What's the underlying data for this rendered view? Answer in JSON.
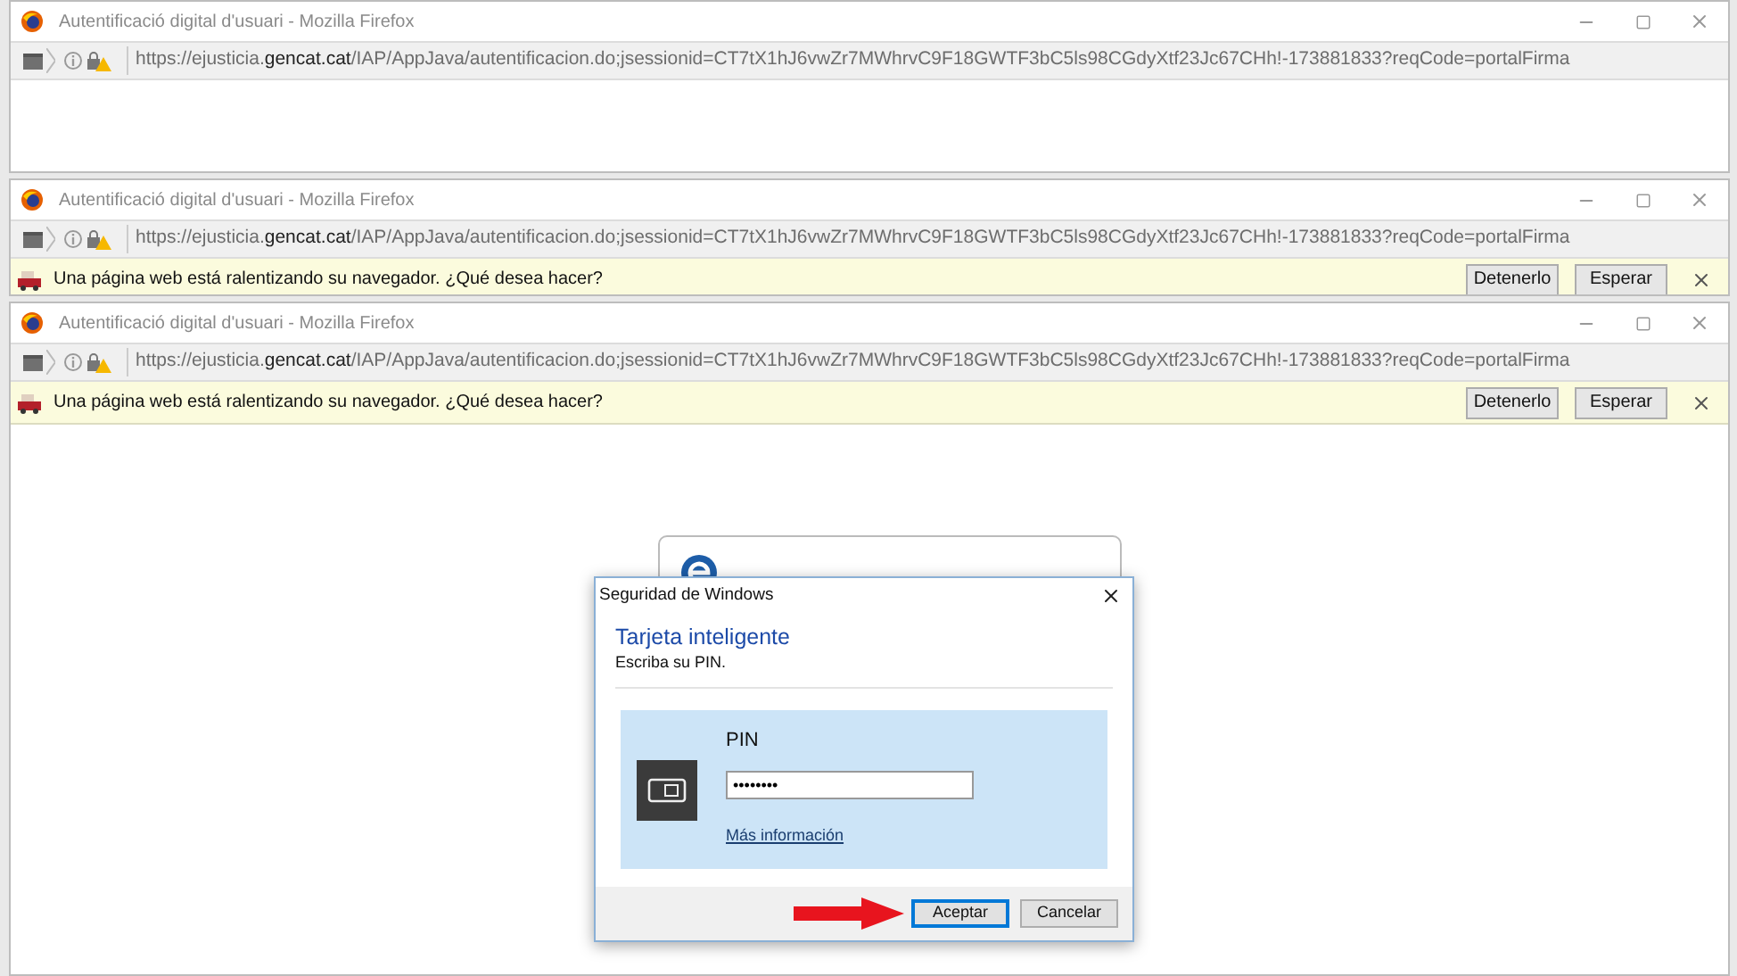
{
  "windows": [
    {
      "title": "Autentificació digital d'usuari - Mozilla Firefox",
      "url": {
        "scheme": "https://ejusticia.",
        "domain": "gencat.cat",
        "path": "/IAP/AppJava/autentificacion.do;jsessionid=CT7tX1hJ6vwZr7MWhrvC9F18GWTF3bC5ls98CGdyXtf23Jc67CHh!-173881833?reqCode=portalFirma"
      }
    },
    {
      "title": "Autentificació digital d'usuari - Mozilla Firefox",
      "url": {
        "scheme": "https://ejusticia.",
        "domain": "gencat.cat",
        "path": "/IAP/AppJava/autentificacion.do;jsessionid=CT7tX1hJ6vwZr7MWhrvC9F18GWTF3bC5ls98CGdyXtf23Jc67CHh!-173881833?reqCode=portalFirma"
      },
      "notification": {
        "message": "Una página web está ralentizando su navegador. ¿Qué desea hacer?",
        "buttons": [
          "Detenerlo",
          "Esperar"
        ]
      }
    },
    {
      "title": "Autentificació digital d'usuari - Mozilla Firefox",
      "url": {
        "scheme": "https://ejusticia.",
        "domain": "gencat.cat",
        "path": "/IAP/AppJava/autentificacion.do;jsessionid=CT7tX1hJ6vwZr7MWhrvC9F18GWTF3bC5ls98CGdyXtf23Jc67CHh!-173881833?reqCode=portalFirma"
      },
      "notification": {
        "message": "Una página web está ralentizando su navegador. ¿Qué desea hacer?",
        "buttons": [
          "Detenerlo",
          "Esperar"
        ]
      }
    }
  ],
  "dialog": {
    "title": "Seguridad de Windows",
    "heading": "Tarjeta inteligente",
    "subtitle": "Escriba su PIN.",
    "field_label": "PIN",
    "pin_value": "••••••••",
    "link": "Más información",
    "buttons": [
      {
        "label": "Aceptar",
        "default": true
      },
      {
        "label": "Cancelar",
        "default": false
      }
    ]
  }
}
